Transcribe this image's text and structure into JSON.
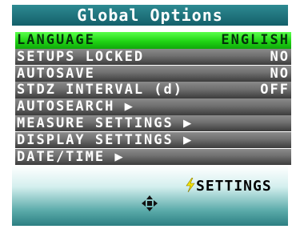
{
  "title": "Global Options",
  "menu": [
    {
      "label": "LANGUAGE",
      "value": "ENGLISH",
      "selected": true
    },
    {
      "label": "SETUPS LOCKED",
      "value": "NO"
    },
    {
      "label": "AUTOSAVE",
      "value": "NO"
    },
    {
      "label": "STDZ INTERVAL (d)",
      "value": "OFF"
    },
    {
      "label": "AUTOSEARCH ▶",
      "value": ""
    },
    {
      "label": "MEASURE SETTINGS ▶",
      "value": ""
    },
    {
      "label": "DISPLAY SETTINGS ▶",
      "value": ""
    },
    {
      "label": "DATE/TIME ▶",
      "value": ""
    }
  ],
  "softkey": {
    "label": "SETTINGS",
    "icon": "lightning-icon"
  },
  "colors": {
    "title_bar": "#1f7680",
    "selected_row": "#22d61a",
    "row": "#6f6f6f",
    "accent_yellow": "#f2e200"
  }
}
